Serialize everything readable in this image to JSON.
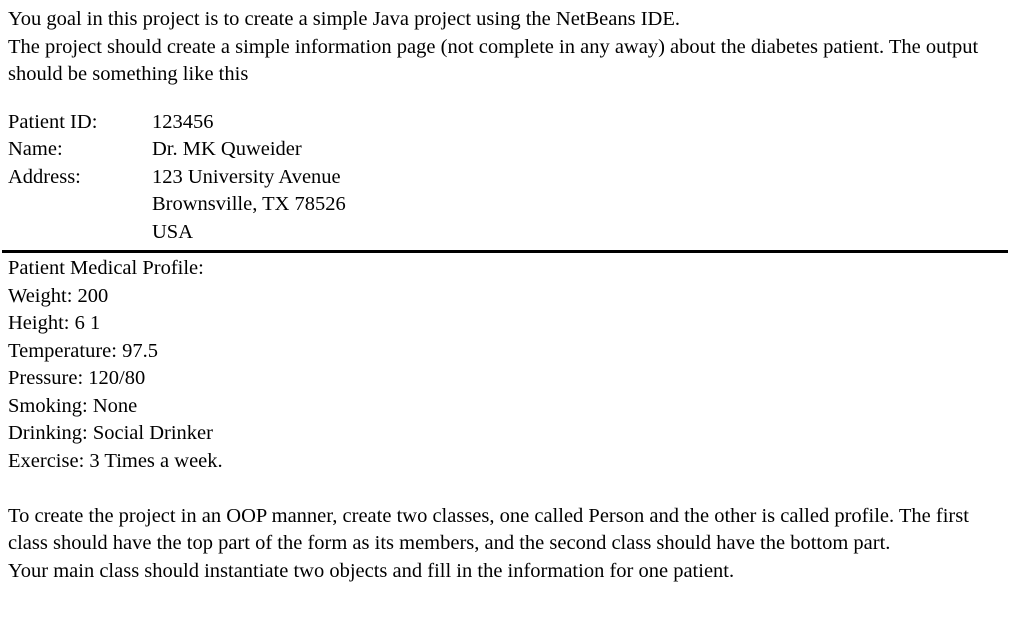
{
  "document": {
    "intro": {
      "line1": "You goal in this project is to create a simple Java project using the NetBeans IDE.",
      "line2": "The project should create a simple information page (not complete in any away) about the diabetes patient. The output should be something like this"
    },
    "patient_info": {
      "rows": [
        {
          "label": "Patient ID:",
          "value": "123456"
        },
        {
          "label": "Name:",
          "value": "Dr. MK Quweider"
        },
        {
          "label": "Address:",
          "value": "123 University Avenue"
        },
        {
          "label": "",
          "value": "Brownsville, TX 78526"
        },
        {
          "label": "",
          "value": "USA"
        }
      ]
    },
    "medical_profile": {
      "heading": "Patient Medical Profile:",
      "lines": [
        "Weight: 200",
        "Height: 6 1",
        "Temperature: 97.5",
        "Pressure: 120/80",
        "Smoking: None",
        "Drinking: Social Drinker",
        "Exercise: 3 Times a week."
      ]
    },
    "instructions": {
      "paragraph": "To create the project in an OOP manner, create two classes, one called Person and the other is called profile. The first class should have the top part of the form as its members, and the second class should have the bottom part.",
      "final_line": "Your main class should instantiate two objects and fill in the information for one patient."
    }
  }
}
